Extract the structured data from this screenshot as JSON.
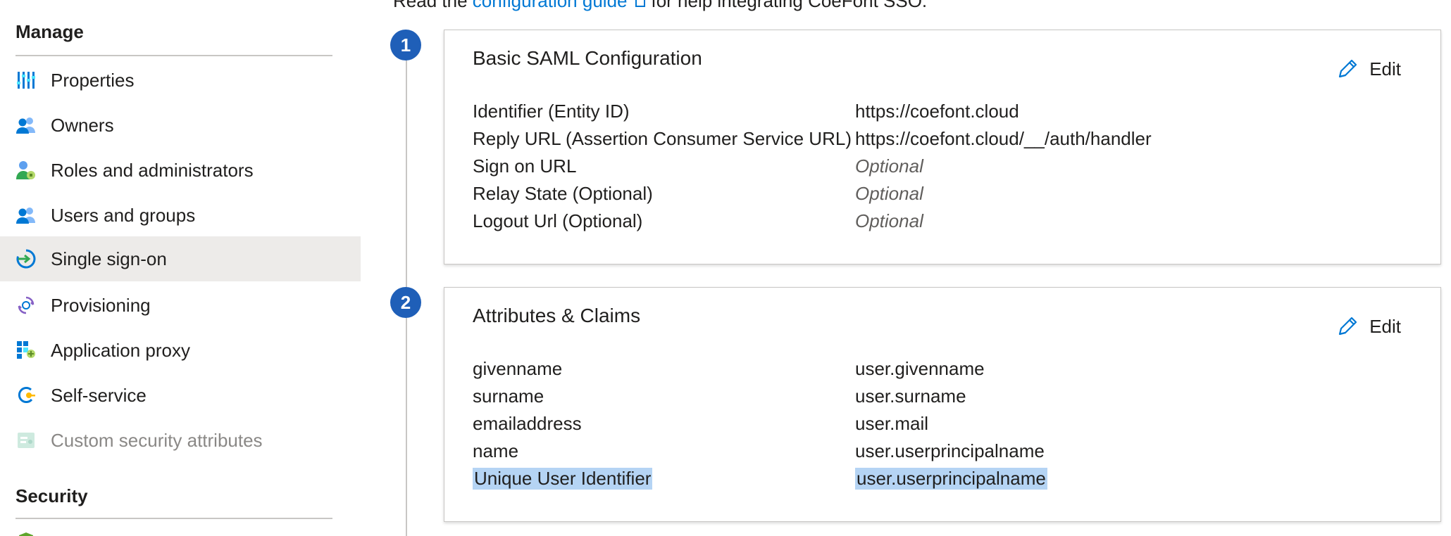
{
  "intro": {
    "prefix": "Read the",
    "link": "configuration guide",
    "suffix": "for help integrating CoeFont SSO."
  },
  "sidebar": {
    "manage_title": "Manage",
    "items": [
      {
        "label": "Properties",
        "icon": "properties-icon"
      },
      {
        "label": "Owners",
        "icon": "owners-icon"
      },
      {
        "label": "Roles and administrators",
        "icon": "roles-icon"
      },
      {
        "label": "Users and groups",
        "icon": "users-groups-icon"
      },
      {
        "label": "Single sign-on",
        "icon": "single-sign-on-icon",
        "selected": true
      },
      {
        "label": "Provisioning",
        "icon": "provisioning-icon"
      },
      {
        "label": "Application proxy",
        "icon": "application-proxy-icon"
      },
      {
        "label": "Self-service",
        "icon": "self-service-icon"
      },
      {
        "label": "Custom security attributes",
        "icon": "custom-security-attributes-icon",
        "disabled": true
      }
    ],
    "security_title": "Security"
  },
  "steps": [
    {
      "number": "1",
      "title": "Basic SAML Configuration",
      "edit_label": "Edit",
      "rows": [
        {
          "key": "Identifier (Entity ID)",
          "value": "https://coefont.cloud"
        },
        {
          "key": "Reply URL (Assertion Consumer Service URL)",
          "value": "https://coefont.cloud/__/auth/handler"
        },
        {
          "key": "Sign on URL",
          "value": "Optional"
        },
        {
          "key": "Relay State (Optional)",
          "value": "Optional"
        },
        {
          "key": "Logout Url (Optional)",
          "value": "Optional"
        }
      ]
    },
    {
      "number": "2",
      "title": "Attributes & Claims",
      "edit_label": "Edit",
      "rows": [
        {
          "key": "givenname",
          "value": "user.givenname"
        },
        {
          "key": "surname",
          "value": "user.surname"
        },
        {
          "key": "emailaddress",
          "value": "user.mail"
        },
        {
          "key": "name",
          "value": "user.userprincipalname"
        },
        {
          "key": "Unique User Identifier",
          "value": "user.userprincipalname"
        }
      ]
    }
  ],
  "colors": {
    "accent": "#0078d4",
    "badge": "#1f5fb8",
    "selected_bg": "#edebe9",
    "highlight": "#b5d4f4"
  }
}
